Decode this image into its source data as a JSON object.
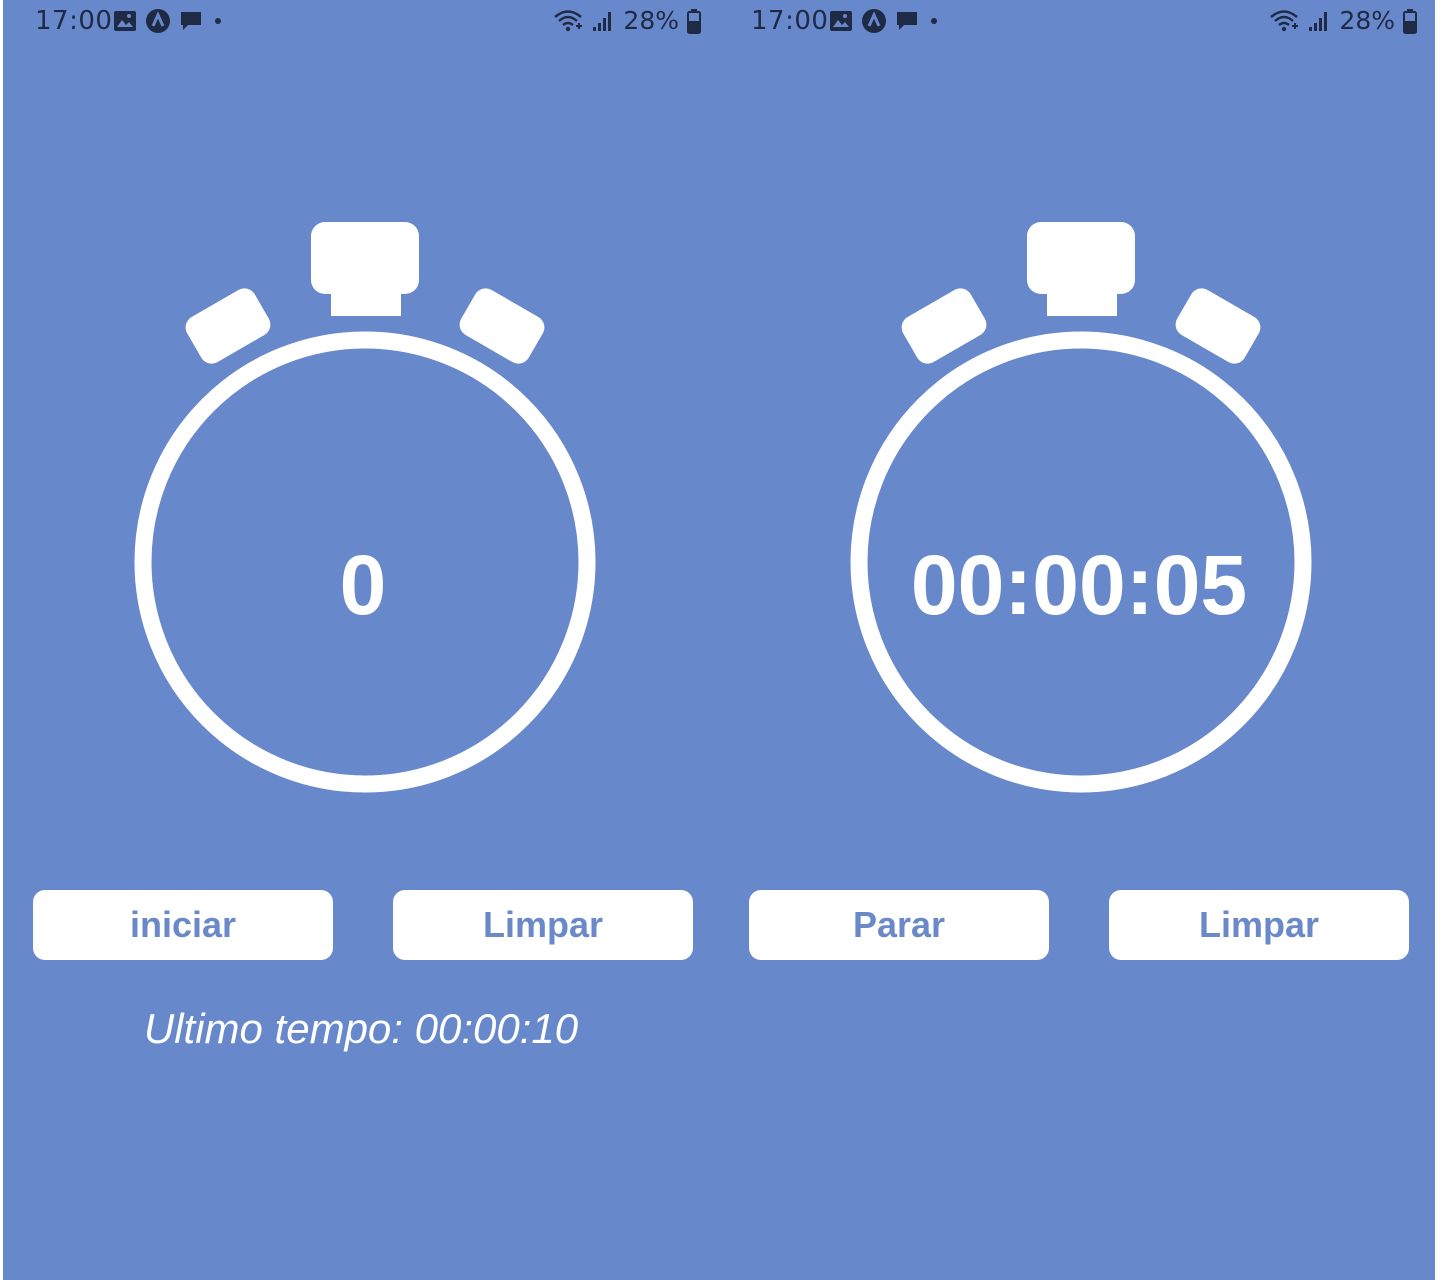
{
  "colors": {
    "background": "#6888cc",
    "foreground": "#ffffff",
    "button_text": "#6b88c8",
    "status_bar_text": "#1f2a44"
  },
  "screens": [
    {
      "status_bar": {
        "time": "17:00",
        "battery": "28%",
        "icons_left": [
          "image-icon",
          "app-icon",
          "message-icon",
          "dot-icon"
        ],
        "icons_right": [
          "wifi-icon",
          "signal-icon",
          "battery-icon"
        ]
      },
      "timer_display": "0",
      "buttons": {
        "primary": "iniciar",
        "secondary": "Limpar"
      },
      "last_time": "Ultimo tempo: 00:00:10"
    },
    {
      "status_bar": {
        "time": "17:00",
        "battery": "28%",
        "icons_left": [
          "image-icon",
          "app-icon",
          "message-icon",
          "dot-icon"
        ],
        "icons_right": [
          "wifi-icon",
          "signal-icon",
          "battery-icon"
        ]
      },
      "timer_display": "00:00:05",
      "buttons": {
        "primary": "Parar",
        "secondary": "Limpar"
      },
      "last_time": ""
    }
  ]
}
